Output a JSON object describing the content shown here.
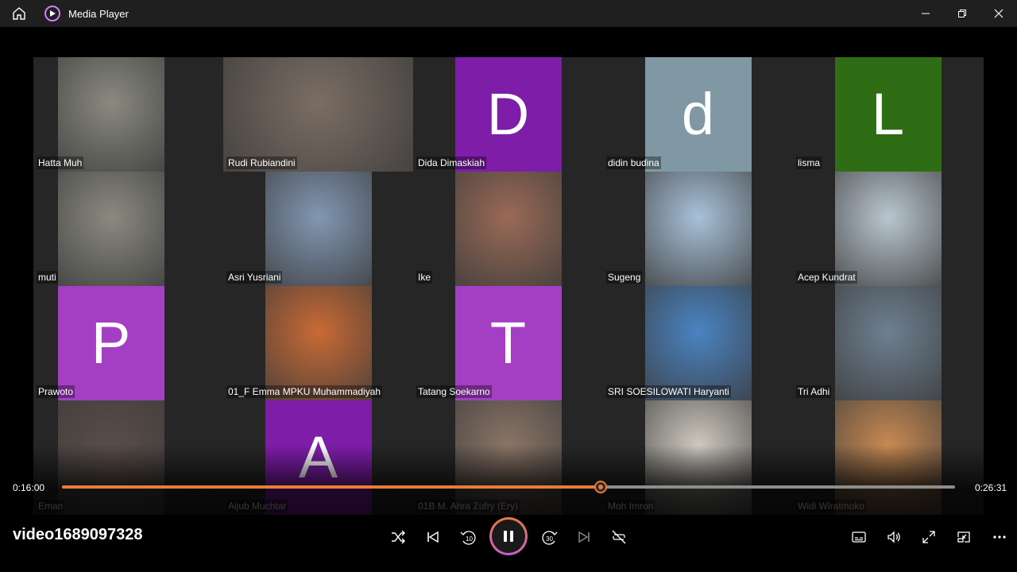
{
  "titlebar": {
    "title": "Media Player"
  },
  "player": {
    "current_time": "0:16:00",
    "total_time": "0:26:31",
    "progress": 0.6035,
    "video_title": "video1689097328",
    "accent": "#e87d38"
  },
  "participants": [
    {
      "name": "Hatta Muh",
      "kind": "photo",
      "color": "#8a8a80"
    },
    {
      "name": "Rudi Rubiandini",
      "kind": "photo",
      "color": "#7b6e63",
      "wide": true
    },
    {
      "name": "Dida Dimaskiah",
      "kind": "letter",
      "letter": "D",
      "color": "#7e1da8"
    },
    {
      "name": "didin budina",
      "kind": "letter",
      "letter": "d",
      "color": "#7f98a4"
    },
    {
      "name": "lisma",
      "kind": "letter",
      "letter": "L",
      "color": "#2f6d15"
    },
    {
      "name": "muti",
      "kind": "photo",
      "color": "#8b8a80"
    },
    {
      "name": "Asri Yusriani",
      "kind": "photo",
      "color": "#8297b3"
    },
    {
      "name": "Ike",
      "kind": "photo",
      "color": "#9a6a56"
    },
    {
      "name": "Sugeng",
      "kind": "photo",
      "color": "#a8c1d9"
    },
    {
      "name": "Acep Kundrat",
      "kind": "photo",
      "color": "#b9c6cf"
    },
    {
      "name": "Prawoto",
      "kind": "letter",
      "letter": "P",
      "color": "#a43fc4"
    },
    {
      "name": "01_F Emma MPKU Muhammadiyah",
      "kind": "photo",
      "color": "#c96a35"
    },
    {
      "name": "Tatang Soekarno",
      "kind": "letter",
      "letter": "T",
      "color": "#a43fc4"
    },
    {
      "name": "SRI SOESILOWATI Haryanti",
      "kind": "photo",
      "color": "#4a83c2"
    },
    {
      "name": "Tri Adhi",
      "kind": "photo",
      "color": "#6e8091"
    },
    {
      "name": "Eman",
      "kind": "photo",
      "color": "#5a4d48"
    },
    {
      "name": "Aijub Muchtar",
      "kind": "letter",
      "letter": "A",
      "color": "#7e1da8"
    },
    {
      "name": "01B M. Ahra Zufry (Ery)",
      "kind": "photo",
      "color": "#8a7566"
    },
    {
      "name": "Moh Imron",
      "kind": "photo",
      "color": "#cfcac0"
    },
    {
      "name": "Widi Wiratmoko",
      "kind": "photo",
      "color": "#c88a52"
    }
  ],
  "icons": {
    "home": "home-icon",
    "app": "media-player-icon",
    "minimize": "minimize-icon",
    "maximize": "maximize-icon",
    "close": "close-icon",
    "shuffle": "shuffle-icon",
    "previous": "previous-icon",
    "rewind": "rewind-10-icon",
    "pause": "pause-icon",
    "forward": "forward-30-icon",
    "next": "next-icon",
    "repeat": "repeat-off-icon",
    "captions": "captions-icon",
    "volume": "volume-icon",
    "fullscreen": "fullscreen-icon",
    "miniplayer": "miniplayer-icon",
    "more": "more-icon"
  }
}
